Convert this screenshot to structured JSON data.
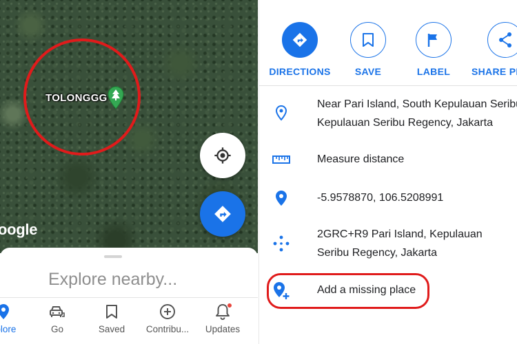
{
  "map": {
    "place_label": "TOLONGGG",
    "watermark": "oogle"
  },
  "explore_sheet": {
    "title": "Explore nearby..."
  },
  "bottom_nav": [
    {
      "label": "xplore",
      "icon": "location-pin-icon",
      "active": true
    },
    {
      "label": "Go",
      "icon": "car-icon",
      "active": false
    },
    {
      "label": "Saved",
      "icon": "bookmark-icon",
      "active": false
    },
    {
      "label": "Contribu...",
      "icon": "add-circle-icon",
      "active": false
    },
    {
      "label": "Updates",
      "icon": "bell-icon",
      "active": false,
      "has_notification_dot": true
    }
  ],
  "actions": [
    {
      "label": "DIRECTIONS",
      "icon": "directions-icon"
    },
    {
      "label": "SAVE",
      "icon": "bookmark-icon"
    },
    {
      "label": "LABEL",
      "icon": "flag-icon"
    },
    {
      "label": "SHARE PL",
      "icon": "share-icon"
    }
  ],
  "details": {
    "address_line1": "Near Pari Island, South Kepulauan Seribu",
    "address_line2": "Kepulauan Seribu Regency, Jakarta",
    "measure": "Measure distance",
    "coordinates": "-5.9578870, 106.5208991",
    "pluscode_line1": "2GRC+R9 Pari Island, Kepulauan",
    "pluscode_line2": "Seribu Regency, Jakarta",
    "add_missing": "Add a missing place"
  },
  "colors": {
    "accent": "#1a73e8",
    "highlight": "#e01b1b",
    "place_pin": "#34a853"
  }
}
